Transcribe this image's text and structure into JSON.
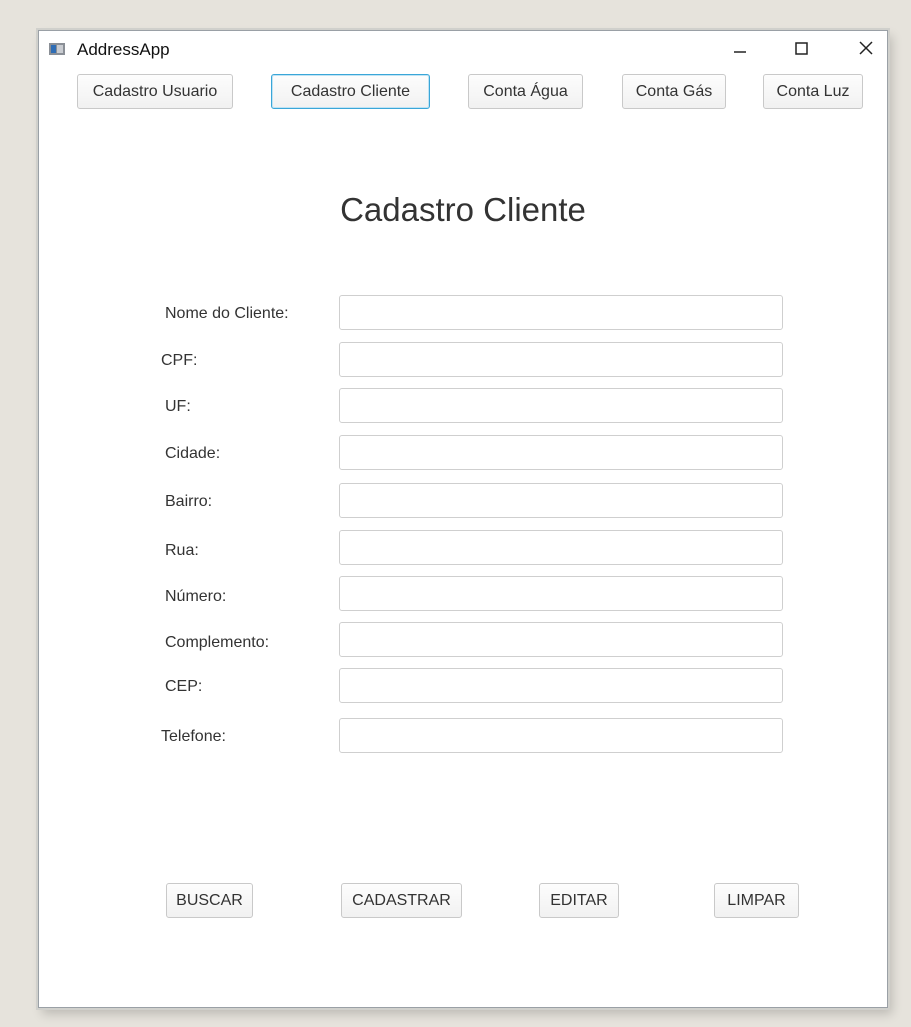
{
  "window": {
    "title": "AddressApp",
    "controls": {
      "minimize": "−",
      "maximize": "☐",
      "close": "✕"
    }
  },
  "tabs": [
    {
      "label": "Cadastro Usuario",
      "active": false
    },
    {
      "label": "Cadastro Cliente",
      "active": true
    },
    {
      "label": "Conta Água",
      "active": false
    },
    {
      "label": "Conta Gás",
      "active": false
    },
    {
      "label": "Conta Luz",
      "active": false
    }
  ],
  "form": {
    "heading": "Cadastro Cliente",
    "fields": [
      {
        "label": "Nome do Cliente:",
        "value": ""
      },
      {
        "label": "CPF:",
        "value": ""
      },
      {
        "label": "UF:",
        "value": ""
      },
      {
        "label": "Cidade:",
        "value": ""
      },
      {
        "label": "Bairro:",
        "value": ""
      },
      {
        "label": "Rua:",
        "value": ""
      },
      {
        "label": "Número:",
        "value": ""
      },
      {
        "label": "Complemento:",
        "value": ""
      },
      {
        "label": "CEP:",
        "value": ""
      },
      {
        "label": "Telefone:",
        "value": ""
      }
    ]
  },
  "actions": {
    "buscar": "BUSCAR",
    "cadastrar": "CADASTRAR",
    "editar": "EDITAR",
    "limpar": "LIMPAR"
  },
  "colors": {
    "active_tab_border": "#3aa6d8"
  }
}
